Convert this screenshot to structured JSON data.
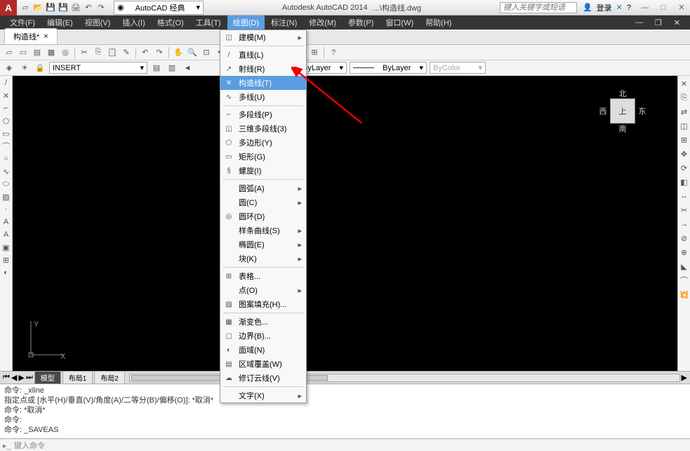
{
  "app_logo": "A",
  "workspace": {
    "icon": "◉",
    "label": "AutoCAD 经典",
    "arrow": "▾"
  },
  "title": {
    "app": "Autodesk AutoCAD 2014",
    "file": "...\\构造线.dwg"
  },
  "search_placeholder": "键入关键字或短语",
  "login_label": "登录",
  "menus": [
    "文件(F)",
    "编辑(E)",
    "视图(V)",
    "插入(I)",
    "格式(O)",
    "工具(T)",
    "绘图(D)",
    "标注(N)",
    "修改(M)",
    "参数(P)",
    "窗口(W)",
    "帮助(H)"
  ],
  "active_menu_index": 6,
  "doc_tab": {
    "label": "构造线*",
    "close": "×"
  },
  "layer_combo": "INSERT",
  "linetype1": "ByLayer",
  "linetype2": "ByLayer",
  "color_combo": "ByColor",
  "dropdown": [
    {
      "type": "item",
      "icon": "◫",
      "label": "建模(M)",
      "sub": true
    },
    {
      "type": "sep"
    },
    {
      "type": "item",
      "icon": "/",
      "label": "直线(L)"
    },
    {
      "type": "item",
      "icon": "↗",
      "label": "射线(R)"
    },
    {
      "type": "item",
      "icon": "✕",
      "label": "构造线(T)",
      "hl": true
    },
    {
      "type": "item",
      "icon": "∿",
      "label": "多线(U)"
    },
    {
      "type": "sep"
    },
    {
      "type": "item",
      "icon": "⌐",
      "label": "多段线(P)"
    },
    {
      "type": "item",
      "icon": "◫",
      "label": "三维多段线(3)"
    },
    {
      "type": "item",
      "icon": "⬠",
      "label": "多边形(Y)"
    },
    {
      "type": "item",
      "icon": "▭",
      "label": "矩形(G)"
    },
    {
      "type": "item",
      "icon": "§",
      "label": "螺旋(I)"
    },
    {
      "type": "sep"
    },
    {
      "type": "item",
      "icon": "",
      "label": "圆弧(A)",
      "sub": true
    },
    {
      "type": "item",
      "icon": "",
      "label": "圆(C)",
      "sub": true
    },
    {
      "type": "item",
      "icon": "◎",
      "label": "圆环(D)"
    },
    {
      "type": "item",
      "icon": "",
      "label": "样条曲线(S)",
      "sub": true
    },
    {
      "type": "item",
      "icon": "",
      "label": "椭圆(E)",
      "sub": true
    },
    {
      "type": "item",
      "icon": "",
      "label": "块(K)",
      "sub": true
    },
    {
      "type": "sep"
    },
    {
      "type": "item",
      "icon": "⊞",
      "label": "表格..."
    },
    {
      "type": "item",
      "icon": "",
      "label": "点(O)",
      "sub": true
    },
    {
      "type": "item",
      "icon": "▨",
      "label": "图案填充(H)..."
    },
    {
      "type": "sep"
    },
    {
      "type": "item",
      "icon": "▦",
      "label": "渐变色..."
    },
    {
      "type": "item",
      "icon": "▢",
      "label": "边界(B)..."
    },
    {
      "type": "item",
      "icon": "◐",
      "label": "面域(N)"
    },
    {
      "type": "item",
      "icon": "▤",
      "label": "区域覆盖(W)"
    },
    {
      "type": "item",
      "icon": "☁",
      "label": "修订云线(V)"
    },
    {
      "type": "sep"
    },
    {
      "type": "item",
      "icon": "",
      "label": "文字(X)",
      "sub": true
    }
  ],
  "viewcube": {
    "n": "北",
    "s": "南",
    "e": "东",
    "w": "西",
    "top": "上"
  },
  "ucs": {
    "x": "X",
    "y": "Y"
  },
  "btm_tabs": [
    "模型",
    "布局1",
    "布局2"
  ],
  "cmd_history": [
    "命令: _xline",
    "指定点或 [水平(H)/垂直(V)/角度(A)/二等分(B)/偏移(O)]: *取消*",
    "命令: *取消*",
    "命令:",
    "命令: _SAVEAS"
  ],
  "cmd_prompt": "键入命令"
}
